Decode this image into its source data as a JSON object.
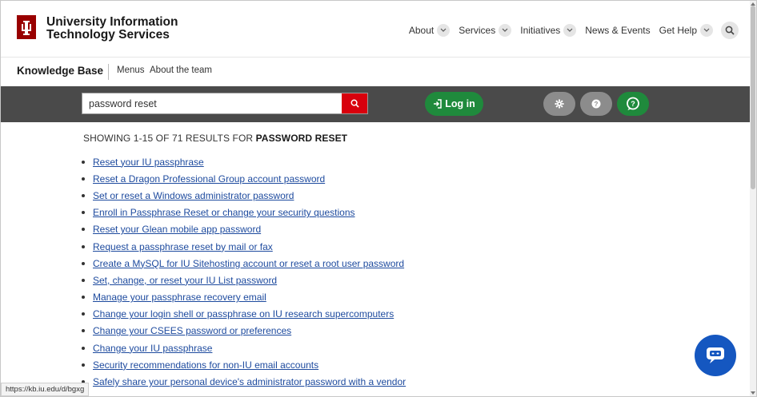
{
  "header": {
    "brand_line1": "University Information",
    "brand_line2": "Technology Services",
    "nav": [
      {
        "label": "About",
        "dropdown": true
      },
      {
        "label": "Services",
        "dropdown": true
      },
      {
        "label": "Initiatives",
        "dropdown": true
      },
      {
        "label": "News & Events",
        "dropdown": false
      },
      {
        "label": "Get Help",
        "dropdown": true
      }
    ],
    "search_icon": "search-icon"
  },
  "kbbar": {
    "title": "Knowledge Base",
    "links": [
      "Menus",
      "About the team"
    ]
  },
  "toolbar": {
    "search_value": "password reset",
    "login_label": "Log in",
    "icons": [
      "gear-icon",
      "help-icon",
      "chat-question-icon"
    ]
  },
  "results": {
    "summary_prefix": "SHOWING 1-15 OF 71 RESULTS FOR",
    "summary_query": "PASSWORD RESET",
    "items": [
      "Reset your IU passphrase",
      "Reset a Dragon Professional Group account password",
      "Set or reset a Windows administrator password",
      "Enroll in Passphrase Reset or change your security questions",
      "Reset your Glean mobile app password",
      "Request a passphrase reset by mail or fax",
      "Create a MySQL for IU Sitehosting account or reset a root user password",
      "Set, change, or reset your IU List password",
      "Manage your passphrase recovery email",
      "Change your login shell or passphrase on IU research supercomputers",
      "Change your CSEES password or preferences",
      "Change your IU passphrase",
      "Security recommendations for non-IU email accounts",
      "Safely share your personal device's administrator password with a vendor"
    ]
  },
  "status_url": "https://kb.iu.edu/d/bgxg",
  "colors": {
    "iu_crimson": "#990000",
    "toolbar_bg": "#4a4a4a",
    "search_red": "#d8000d",
    "login_green": "#1f8a3c",
    "link_blue": "#1d4a9e",
    "chat_blue": "#1557c0"
  }
}
